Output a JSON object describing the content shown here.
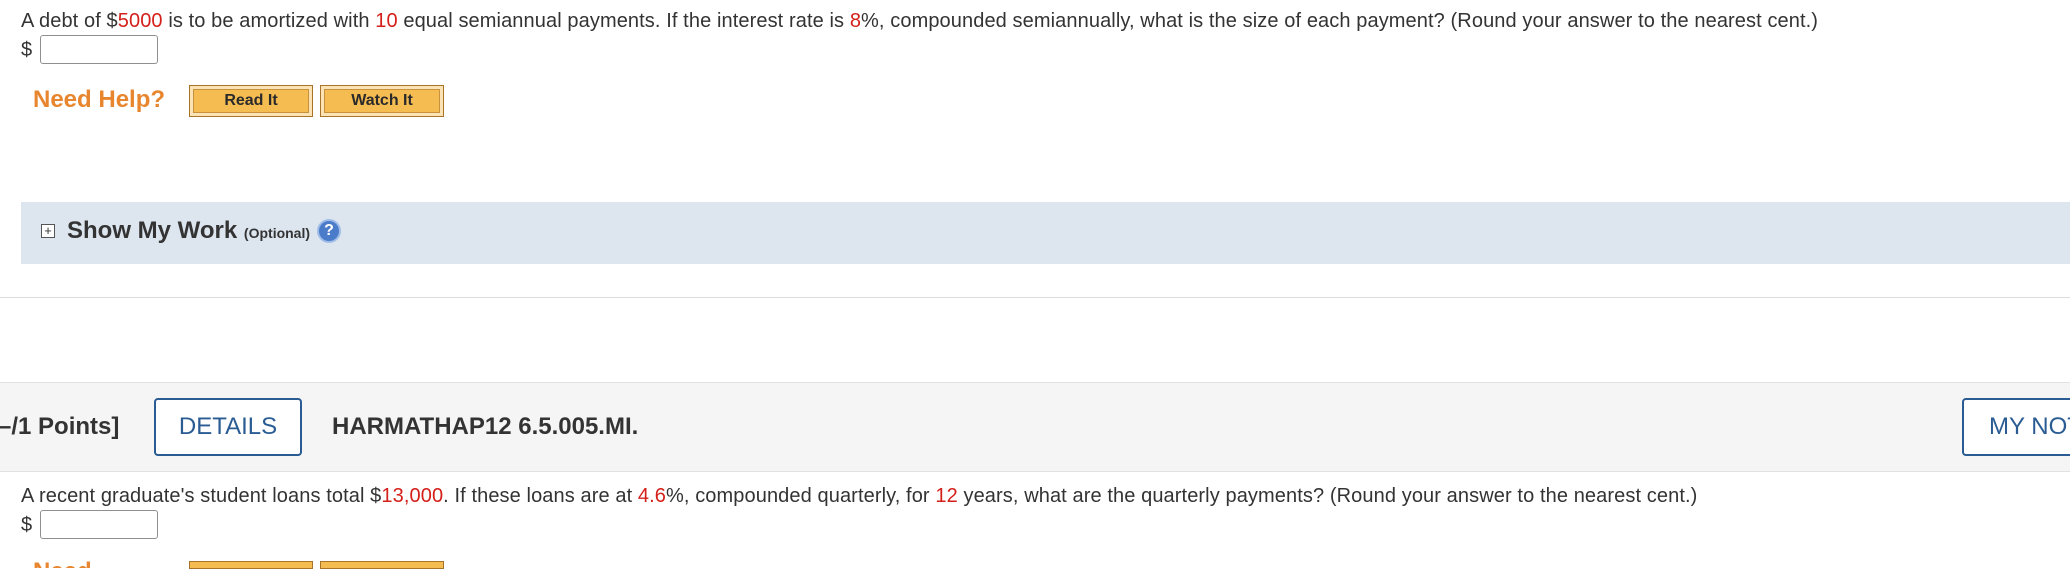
{
  "question1": {
    "text_parts": [
      "A debt of $",
      "5000",
      " is to be amortized with ",
      "10",
      " equal semiannual payments. If the interest rate is ",
      "8",
      "%, compounded semiannually, what is the size of each payment? (Round your answer to the nearest cent.)"
    ],
    "currency": "$",
    "answer_value": ""
  },
  "help": {
    "label": "Need Help?",
    "read_it": "Read It",
    "watch_it": "Watch It"
  },
  "show_my_work": {
    "expand_symbol": "+",
    "title": "Show My Work",
    "optional": "(Optional)",
    "help_symbol": "?"
  },
  "question2": {
    "points": "–/1 Points]",
    "details_label": "DETAILS",
    "id": "HARMATHAP12 6.5.005.MI.",
    "my_notes_label": "MY NOTES",
    "text_parts": [
      "A recent graduate's student loans total $",
      "13,000",
      ". If these loans are at ",
      "4.6",
      "%, compounded quarterly, for ",
      "12",
      " years, what are the quarterly payments? (Round your answer to the nearest cent.)"
    ],
    "currency": "$",
    "answer_value": ""
  },
  "colors": {
    "highlight": "#d4201a",
    "help_orange": "#e8862f",
    "button_blue": "#2a5c93"
  }
}
